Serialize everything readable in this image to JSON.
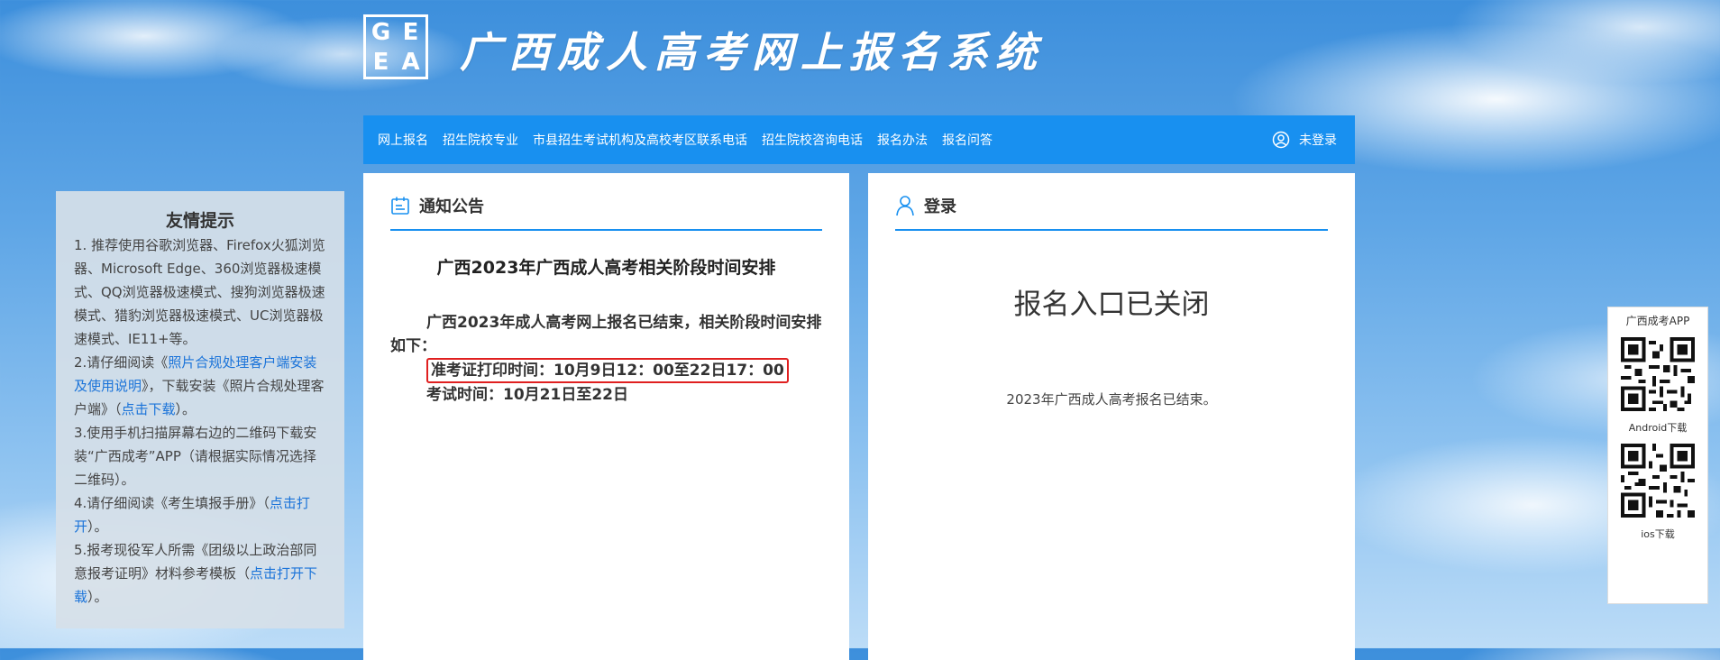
{
  "header": {
    "logo_letters": [
      "G",
      "E",
      "E",
      "A"
    ],
    "site_title": "广西成人高考网上报名系统"
  },
  "nav": {
    "items": [
      {
        "label": "网上报名"
      },
      {
        "label": "招生院校专业"
      },
      {
        "label": "市县招生考试机构及高校考区联系电话"
      },
      {
        "label": "招生院校咨询电话"
      },
      {
        "label": "报名办法"
      },
      {
        "label": "报名问答"
      }
    ],
    "user_label": "未登录",
    "user_icon": "user-circle-icon"
  },
  "tips": {
    "title": "友情提示",
    "item1": "1. 推荐使用谷歌浏览器、Firefox火狐浏览器、Microsoft Edge、360浏览器极速模式、QQ浏览器极速模式、搜狗浏览器极速模式、猎豹浏览器极速模式、UC浏览器极速模式、IE11+等。",
    "item2_pre": "2.请仔细阅读《",
    "item2_link1": "照片合规处理客户端安装及使用说明",
    "item2_mid": "》，下载安装《照片合规处理客户端》（",
    "item2_link2": "点击下载",
    "item2_post": "）。",
    "item3": "3.使用手机扫描屏幕右边的二维码下载安装“广西成考”APP（请根据实际情况选择二维码）。",
    "item4_pre": "4.请仔细阅读《考生填报手册》（",
    "item4_link": "点击打开",
    "item4_post": "）。",
    "item5_pre": "5.报考现役军人所需《团级以上政治部同意报考证明》材料参考模板（",
    "item5_link": "点击打开下载",
    "item5_post": "）。"
  },
  "notice": {
    "head_title": "通知公告",
    "head_icon": "calendar-notice-icon",
    "title": "广西2023年广西成人高考相关阶段时间安排",
    "intro": "广西2023年成人高考网上报名已结束，相关阶段时间安排如下：",
    "print_time": "准考证打印时间：10月9日12：00至22日17：00",
    "exam_time": "考试时间：10月21日至22日"
  },
  "login": {
    "head_title": "登录",
    "head_icon": "user-outline-icon",
    "closed_title": "报名入口已关闭",
    "closed_text": "2023年广西成人高考报名已结束。"
  },
  "app": {
    "title": "广西成考APP",
    "android_label": "Android下载",
    "ios_label": "ios下载"
  },
  "colors": {
    "nav_bg": "#1890f0",
    "link": "#1a73d9",
    "highlight_border": "#e02020"
  }
}
